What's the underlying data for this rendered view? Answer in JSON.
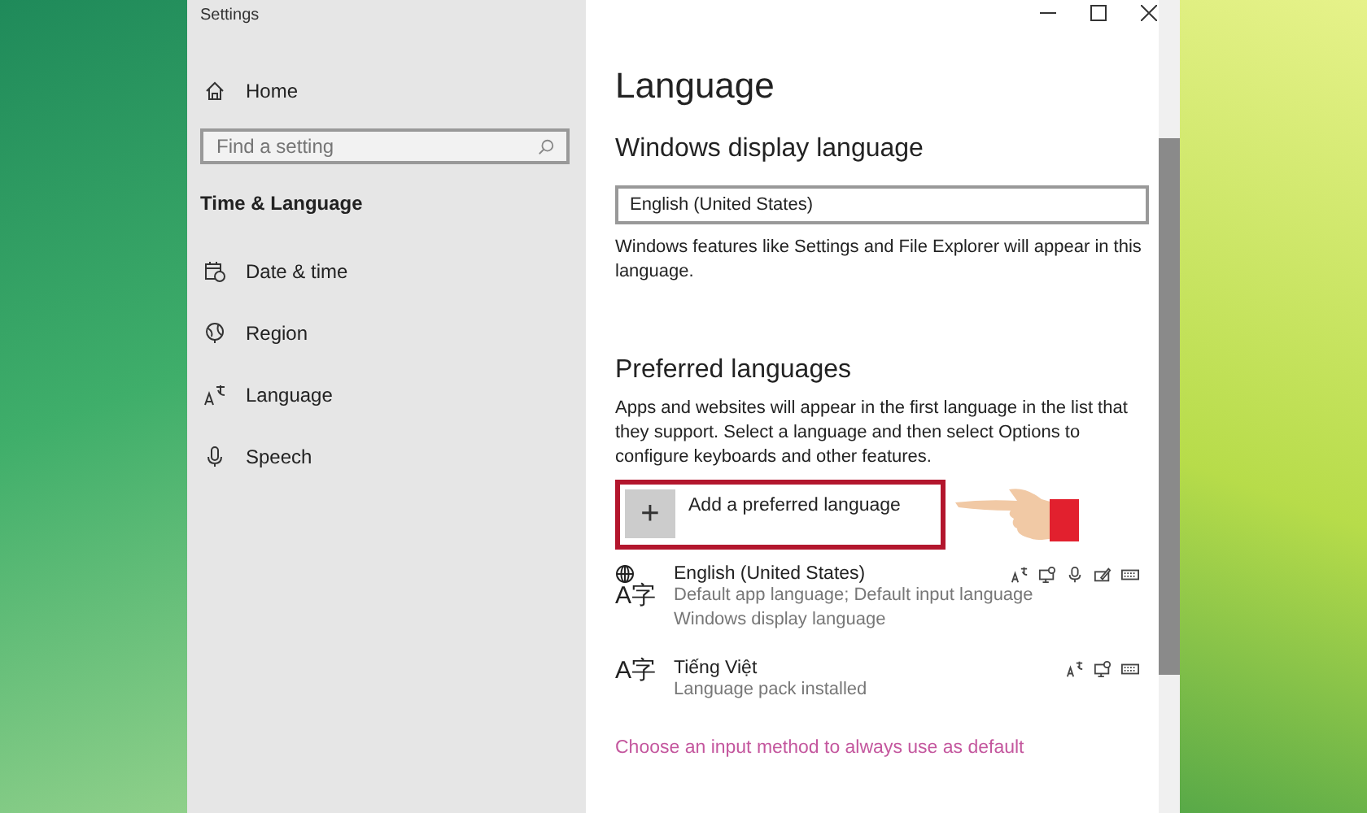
{
  "window": {
    "title": "Settings"
  },
  "sidebar": {
    "home": "Home",
    "search": {
      "placeholder": "Find a setting"
    },
    "section": "Time & Language",
    "items": [
      {
        "label": "Date & time",
        "kind": "calendar"
      },
      {
        "label": "Region",
        "kind": "globe"
      },
      {
        "label": "Language",
        "kind": "language"
      },
      {
        "label": "Speech",
        "kind": "mic"
      }
    ]
  },
  "page": {
    "title": "Language",
    "display_heading": "Windows display language",
    "display_value": "English (United States)",
    "display_note": "Windows features like Settings and File Explorer will appear in this language.",
    "preferred_heading": "Preferred languages",
    "preferred_note": "Apps and websites will appear in the first language in the list that they support. Select a language and then select Options to configure keyboards and other features.",
    "add_button": {
      "icon": "+",
      "label": "Add a preferred language"
    },
    "languages": [
      {
        "icon": "A字",
        "globe": true,
        "name": "English (United States)",
        "details": [
          "Default app language; Default input language",
          "Windows display language"
        ],
        "features": [
          {
            "kind": "speech"
          },
          {
            "kind": "display"
          },
          {
            "kind": "mic"
          },
          {
            "kind": "handwriting"
          },
          {
            "kind": "keyboard"
          }
        ]
      },
      {
        "icon": "A字",
        "globe": false,
        "name": "Tiếng Việt",
        "details": [
          "Language pack installed"
        ],
        "features": [
          {
            "kind": "speech"
          },
          {
            "kind": "display"
          },
          {
            "kind": "keyboard"
          }
        ]
      }
    ],
    "link": "Choose an input method to always use as default"
  }
}
